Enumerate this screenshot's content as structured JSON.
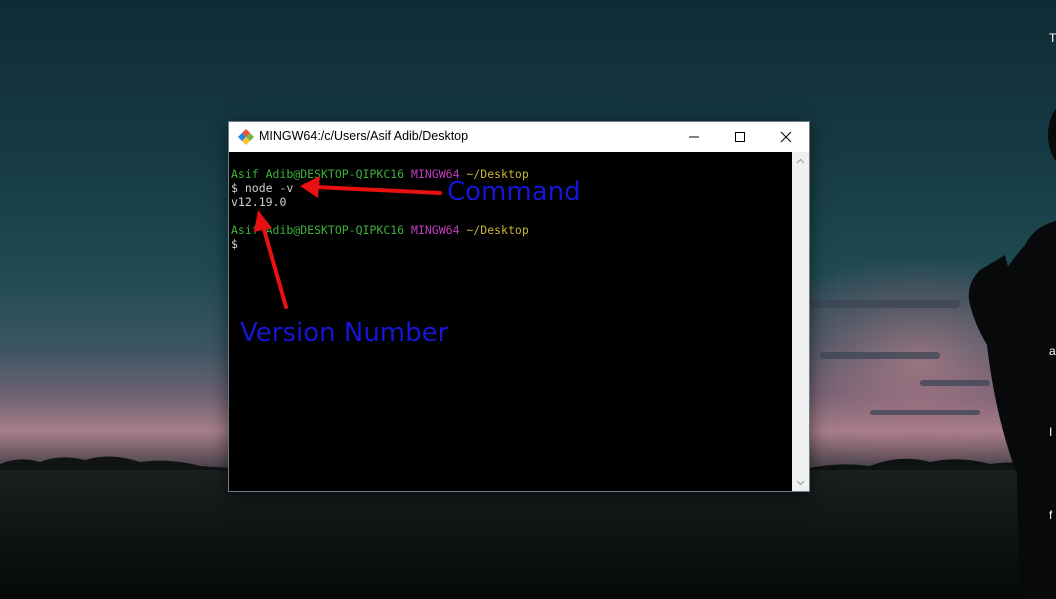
{
  "window": {
    "title": "MINGW64:/c/Users/Asif Adib/Desktop",
    "minimize_icon": "minimize-icon",
    "maximize_icon": "maximize-icon",
    "close_icon": "close-icon",
    "app_icon": "git-diamond-icon"
  },
  "terminal": {
    "prompt1": {
      "user_host": "Asif Adib@DESKTOP-QIPKC16",
      "shell": "MINGW64",
      "path": "~/Desktop"
    },
    "command_line": "$ node -v",
    "output": "v12.19.0",
    "prompt2": {
      "user_host": "Asif Adib@DESKTOP-QIPKC16",
      "shell": "MINGW64",
      "path": "~/Desktop"
    },
    "cursor_line": "$"
  },
  "annotations": {
    "command_label": "Command",
    "version_label": "Version Number",
    "arrow_color": "#e81010",
    "label_color": "#1616d6"
  },
  "desktop": {
    "edge_text": [
      "T",
      "a",
      "I",
      "f"
    ]
  },
  "colors": {
    "prompt_green": "#3bb13b",
    "prompt_magenta": "#c13cbd",
    "prompt_yellow": "#c8b63c"
  }
}
